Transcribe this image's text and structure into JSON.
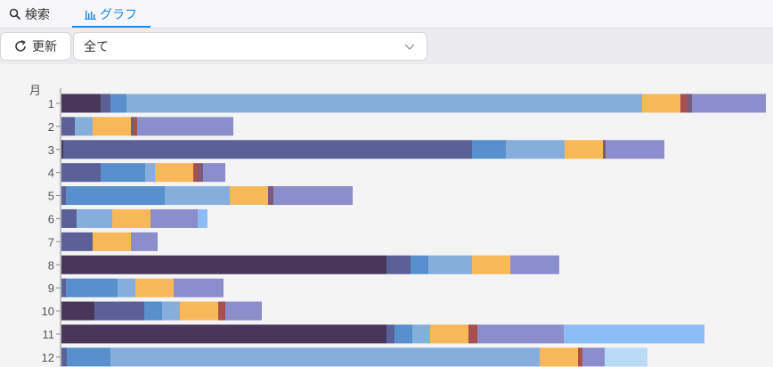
{
  "tabs": [
    {
      "label": "検索",
      "icon": "search-icon",
      "active": false
    },
    {
      "label": "グラフ",
      "icon": "bar-chart-icon",
      "active": true
    }
  ],
  "toolbar": {
    "refresh_label": "更新",
    "refresh_icon": "refresh-icon",
    "filter_value": "全て",
    "filter_icon": "chevron-down-icon"
  },
  "colors": {
    "accent": "#1e88e5",
    "palette": [
      "#483758",
      "#5b6098",
      "#5790cc",
      "#86aedd",
      "#f7b85a",
      "#a8504f",
      "#7a5b7a",
      "#8c8dcb",
      "#8cbcf5",
      "#b8dbf8"
    ]
  },
  "chart_data": {
    "type": "bar",
    "orientation": "horizontal",
    "stacked": true,
    "ylabel": "月",
    "categories": [
      "1",
      "2",
      "3",
      "4",
      "5",
      "6",
      "7",
      "8",
      "9",
      "10",
      "11",
      "12"
    ],
    "segments": [
      [
        44,
        11,
        18,
        579,
        43,
        7,
        6,
        83
      ],
      [
        15,
        20,
        43,
        4,
        3,
        108
      ],
      [
        2,
        459,
        38,
        66,
        43,
        3,
        66
      ],
      [
        44,
        50,
        11,
        43,
        5,
        6,
        25
      ],
      [
        5,
        111,
        73,
        43,
        6,
        89
      ],
      [
        17,
        40,
        43,
        53,
        11
      ],
      [
        35,
        43,
        30
      ],
      [
        365,
        27,
        20,
        49,
        43,
        55
      ],
      [
        5,
        58,
        20,
        43,
        56
      ],
      [
        37,
        56,
        20,
        20,
        43,
        8,
        41
      ],
      [
        365,
        9,
        20,
        20,
        43,
        10,
        97,
        158
      ],
      [
        6,
        49,
        482,
        43,
        5,
        25,
        48
      ]
    ],
    "segment_colors": [
      [
        "#483758",
        "#5b6098",
        "#5790cc",
        "#86aedd",
        "#f7b85a",
        "#a8504f",
        "#7a5b7a",
        "#8c8dcb"
      ],
      [
        "#5b6098",
        "#86aedd",
        "#f7b85a",
        "#7a5b7a",
        "#a8504f",
        "#8c8dcb"
      ],
      [
        "#483758",
        "#5b6098",
        "#5790cc",
        "#86aedd",
        "#f7b85a",
        "#7a5b7a",
        "#8c8dcb"
      ],
      [
        "#5b6098",
        "#5790cc",
        "#86aedd",
        "#f7b85a",
        "#a8504f",
        "#7a5b7a",
        "#8c8dcb"
      ],
      [
        "#5b6098",
        "#5790cc",
        "#86aedd",
        "#f7b85a",
        "#7a5b7a",
        "#8c8dcb"
      ],
      [
        "#5b6098",
        "#86aedd",
        "#f7b85a",
        "#8c8dcb",
        "#8cbcf5"
      ],
      [
        "#5b6098",
        "#f7b85a",
        "#8c8dcb"
      ],
      [
        "#483758",
        "#5b6098",
        "#5790cc",
        "#86aedd",
        "#f7b85a",
        "#8c8dcb"
      ],
      [
        "#5b6098",
        "#5790cc",
        "#86aedd",
        "#f7b85a",
        "#8c8dcb"
      ],
      [
        "#483758",
        "#5b6098",
        "#5790cc",
        "#86aedd",
        "#f7b85a",
        "#a8504f",
        "#8c8dcb"
      ],
      [
        "#483758",
        "#5b6098",
        "#5790cc",
        "#86aedd",
        "#f7b85a",
        "#a8504f",
        "#8c8dcb",
        "#8cbcf5"
      ],
      [
        "#5b6098",
        "#5790cc",
        "#86aedd",
        "#f7b85a",
        "#a8504f",
        "#8c8dcb",
        "#b8dbf8"
      ]
    ],
    "xlim": [
      0,
      800
    ],
    "grid": false,
    "legend": "none"
  }
}
